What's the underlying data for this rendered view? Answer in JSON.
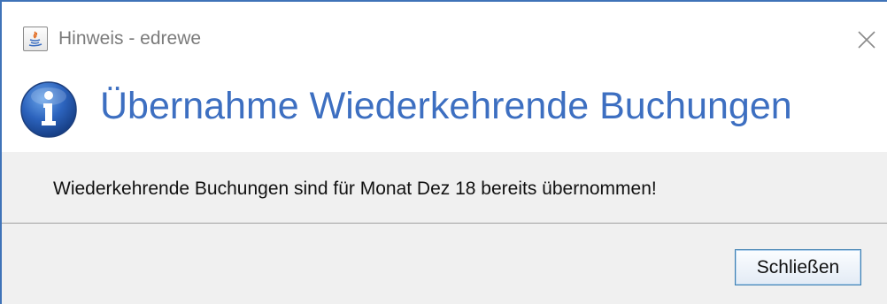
{
  "window": {
    "title": "Hinweis - edrewe"
  },
  "icons": {
    "app": "java-app-icon",
    "close": "close-icon",
    "info": "info-icon"
  },
  "header": {
    "heading": "Übernahme Wiederkehrende Buchungen"
  },
  "body": {
    "message": "Wiederkehrende Buchungen sind für Monat Dez 18 bereits übernommen!"
  },
  "footer": {
    "close_button_label": "Schließen"
  },
  "colors": {
    "window_border": "#3f73b8",
    "heading": "#3d6fc1",
    "content_background": "#f0f0f0",
    "button_border": "#3c7fb1"
  }
}
